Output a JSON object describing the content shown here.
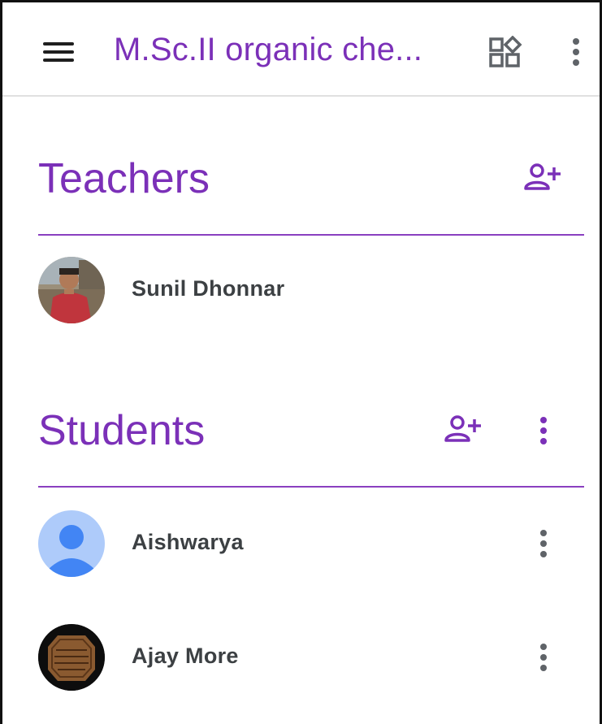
{
  "header": {
    "class_title": "M.Sc.II organic che...",
    "icons": {
      "menu": "hamburger-menu-icon",
      "apps": "apps-grid-icon",
      "more": "more-vert-icon"
    }
  },
  "teachers": {
    "title": "Teachers",
    "add_icon": "person-add-icon",
    "list": [
      {
        "name": "Sunil Dhonnar",
        "avatar": "photo"
      }
    ]
  },
  "students": {
    "title": "Students",
    "add_icon": "person-add-icon",
    "more_icon": "more-vert-icon",
    "list": [
      {
        "name": "Aishwarya",
        "avatar": "default-person-icon"
      },
      {
        "name": "Ajay More",
        "avatar": "seal-photo"
      }
    ]
  },
  "colors": {
    "accent": "#7b30b8",
    "divider": "#8a3fc0",
    "text": "#3c4043",
    "default_avatar_bg": "#aecbfa",
    "default_avatar_fg": "#4285f4"
  }
}
